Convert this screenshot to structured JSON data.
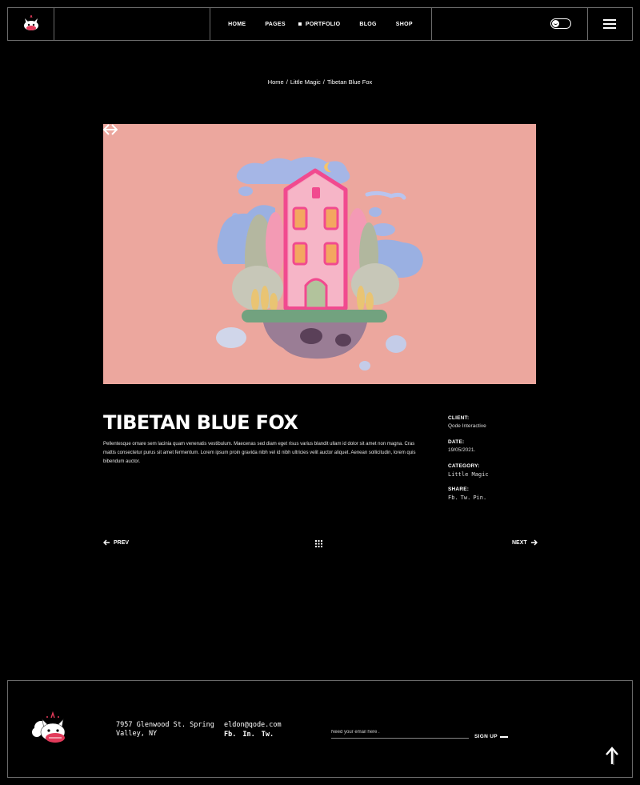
{
  "header": {
    "nav": [
      {
        "label": "HOME",
        "active": false
      },
      {
        "label": "PAGES",
        "active": false
      },
      {
        "label": "PORTFOLIO",
        "active": true
      },
      {
        "label": "BLOG",
        "active": false
      },
      {
        "label": "SHOP",
        "active": false
      }
    ]
  },
  "breadcrumb": {
    "home": "Home",
    "category": "Little Magic",
    "current": "Tibetan Blue Fox",
    "separator": "/"
  },
  "project": {
    "title": "TIBETAN BLUE FOX",
    "description": "Pellentesque ornare sem lacinia quam venenatis vestibulum. Maecenas sed diam eget risus varius blandit ullam id dolor sit amet non magna. Cras mattis consectetur purus sit amet fermentum. Lorem ipsum proin gravida nibh vel id nibh ultricies velit auctor aliquet. Aenean sollicitudin, lorem quis bibendum auctor.",
    "meta": {
      "client_label": "CLIENT:",
      "client_value": "Qode Interactive",
      "date_label": "DATE:",
      "date_value": "19/05/2021.",
      "category_label": "CATEGORY:",
      "category_value": "Little Magic",
      "share_label": "SHARE:",
      "share_links": [
        "Fb.",
        "Tw.",
        "Pin."
      ]
    }
  },
  "pager": {
    "prev": "PREV",
    "next": "NEXT"
  },
  "footer": {
    "address": "7957 Glenwood St. Spring Valley, NY",
    "email": "eldon@qode.com",
    "social": [
      "Fb.",
      "In.",
      "Tw."
    ],
    "newsletter_placeholder": "Need your email here .",
    "signup_label": "SIGN UP"
  },
  "colors": {
    "background": "#000000",
    "hero_bg": "#eca79e",
    "border": "#6b6b6b",
    "house_pink": "#f07ab0"
  },
  "icons": [
    "logo-fox-icon",
    "toggle-icon",
    "menu-icon",
    "arrow-left-icon",
    "arrow-right-icon",
    "grid-icon",
    "arrow-up-icon"
  ]
}
